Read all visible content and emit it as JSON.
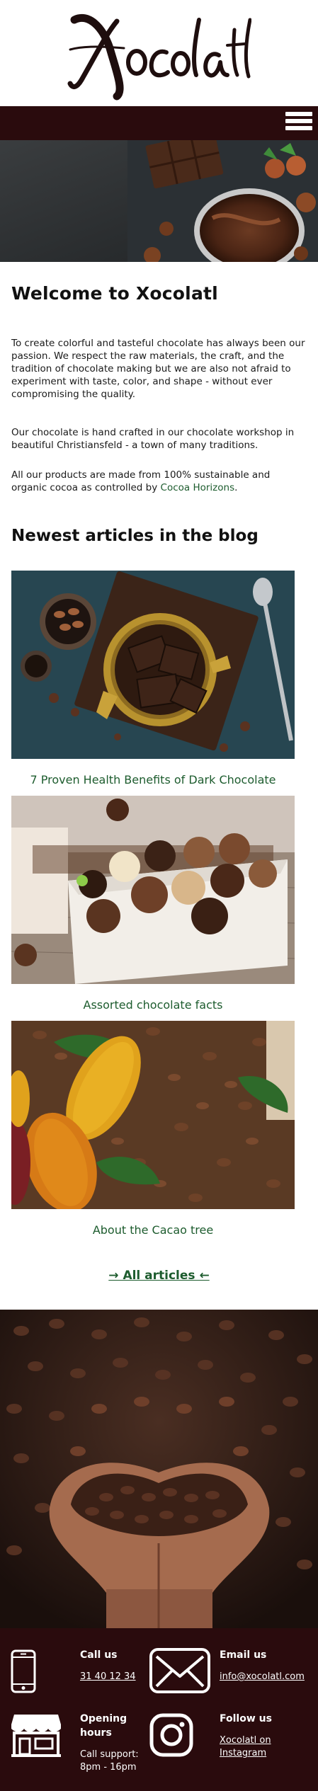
{
  "brand": {
    "logo_text": "Xocolatl"
  },
  "nav": {
    "menu_icon": "hamburger-menu-icon"
  },
  "welcome": {
    "title": "Welcome to Xocolatl",
    "p1": "To create colorful and tasteful chocolate has always been our passion. We respect the raw materials, the craft, and the tradition of chocolate making but we are also not afraid to experiment with taste, color, and shape - without ever compromising the quality.",
    "p2": "Our chocolate is hand crafted in our chocolate workshop in beautiful Christiansfeld - a town of many traditions.",
    "p3_before": "All our products are made from 100% sustainable and organic cocoa as controlled by ",
    "p3_link": "Cocoa Horizons",
    "p3_after": "."
  },
  "blog": {
    "title": "Newest articles in the blog",
    "articles": [
      {
        "title": "7 Proven Health Benefits of Dark Chocolate"
      },
      {
        "title": "Assorted chocolate facts"
      },
      {
        "title": "About the Cacao tree"
      }
    ],
    "all_articles": "→ All articles ←"
  },
  "footer": {
    "call": {
      "label": "Call us",
      "value": "31 40 12 34",
      "icon": "phone-icon"
    },
    "email": {
      "label": "Email us",
      "value": "info@xocolatl.com",
      "icon": "envelope-icon"
    },
    "hours": {
      "label_1": "Opening",
      "label_2": "hours",
      "value_1": "Call support:",
      "value_2": "8pm - 16pm",
      "icon": "shop-icon"
    },
    "follow": {
      "label": "Follow us",
      "value_1": "Xocolatl on",
      "value_2": "Instagram",
      "icon": "instagram-icon"
    }
  },
  "colors": {
    "brand_dark": "#2a0b0d",
    "link_green": "#1d5c2e"
  }
}
